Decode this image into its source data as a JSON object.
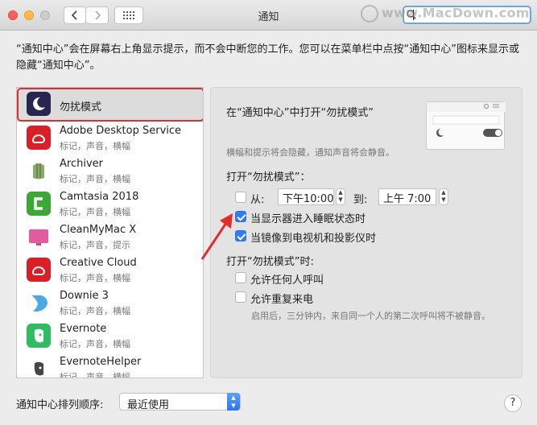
{
  "window": {
    "title": "通知"
  },
  "watermark": "www.MacDown.com",
  "description": "“通知中心”会在屏幕右上角显示提示，而不会中断您的工作。您可以在菜单栏中点按“通知中心”图标来显示或隐藏“通知中心”。",
  "apps": [
    {
      "name": "勿扰模式",
      "sub": "",
      "icon": "moon-icon",
      "color": "#262650",
      "selected": true
    },
    {
      "name": "Adobe Desktop Service",
      "sub": "标记，声音，横幅",
      "icon": "adobe-cc-icon",
      "color": "#da1f26"
    },
    {
      "name": "Archiver",
      "sub": "标记，声音，横幅",
      "icon": "archiver-icon",
      "color": "#8aaa6a"
    },
    {
      "name": "Camtasia 2018",
      "sub": "标记，声音，横幅",
      "icon": "camtasia-icon",
      "color": "#3aaa35"
    },
    {
      "name": "CleanMyMac X",
      "sub": "标记，声音，提示",
      "icon": "cleanmymac-icon",
      "color": "#e45a9e"
    },
    {
      "name": "Creative Cloud",
      "sub": "标记，声音，横幅",
      "icon": "creative-cloud-icon",
      "color": "#da1f26"
    },
    {
      "name": "Downie 3",
      "sub": "标记，声音，横幅",
      "icon": "downie-icon",
      "color": "#4aa8e8"
    },
    {
      "name": "Evernote",
      "sub": "标记，声音，横幅",
      "icon": "evernote-icon",
      "color": "#2dbe60"
    },
    {
      "name": "EvernoteHelper",
      "sub": "标记，声音，横幅",
      "icon": "evernote-helper-icon",
      "color": "#2dbe60"
    }
  ],
  "panel": {
    "heading": "在“通知中心”中打开“勿扰模式”",
    "hint": "横幅和提示将会隐藏，通知声音将会静音。",
    "schedule_label": "打开“勿扰模式”：",
    "from_label": "从:",
    "from_time": "下午10:00",
    "to_label": "到:",
    "to_time": "上午 7:00",
    "sleep_label": "当显示器进入睡眠状态时",
    "mirror_label": "当镜像到电视机和投影仪时",
    "when_on_label": "打开“勿扰模式”时:",
    "allow_calls_label": "允许任何人呼叫",
    "repeat_calls_label": "允许重复来电",
    "repeat_hint": "启用后，三分钟内，来自同一个人的第二次呼叫将不被静音。",
    "from_checked": false,
    "sleep_checked": true,
    "mirror_checked": true,
    "allow_calls_checked": false,
    "repeat_calls_checked": false
  },
  "footer": {
    "sort_label": "通知中心排列顺序:",
    "sort_value": "最近使用",
    "help": "?"
  }
}
